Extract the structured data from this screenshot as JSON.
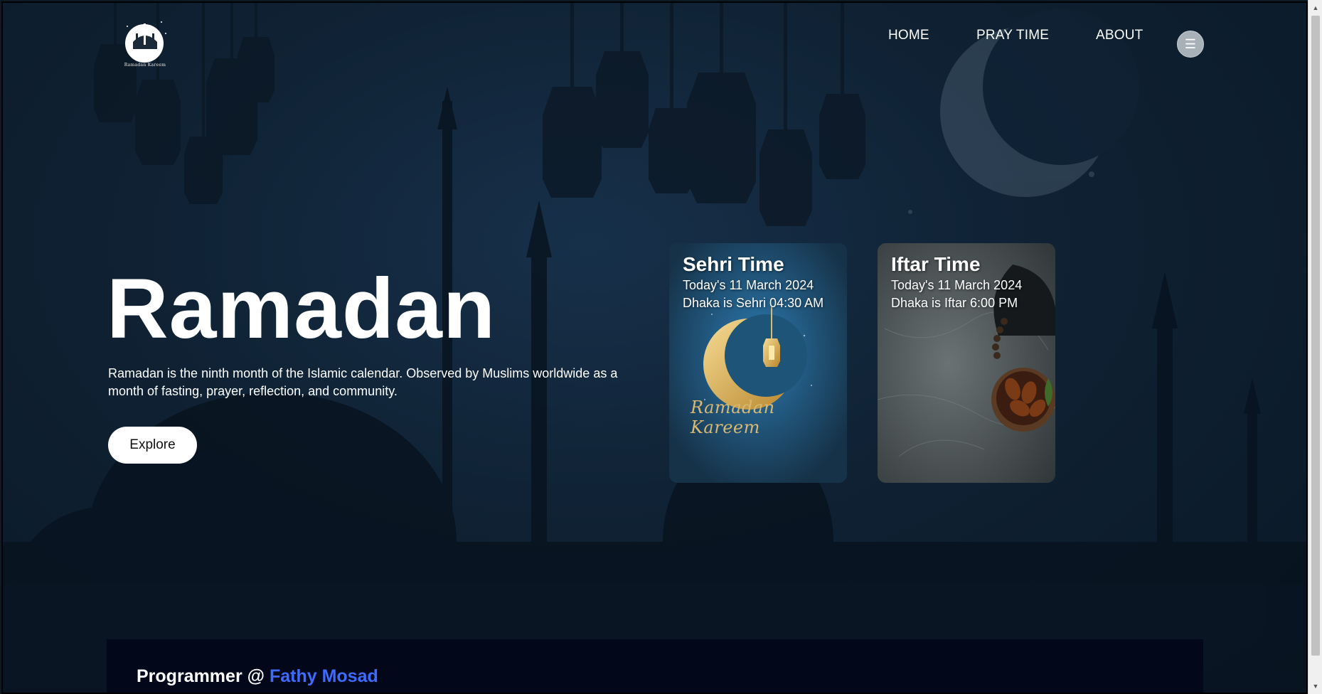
{
  "logo": {
    "caption": "Ramadan Kareem"
  },
  "nav": {
    "home": "HOME",
    "pray_time": "PRAY TIME",
    "about": "ABOUT",
    "menu_icon": "menu-icon"
  },
  "hero": {
    "title": "Ramadan",
    "description": "Ramadan is the ninth month of the Islamic calendar. Observed by Muslims worldwide as a month of fasting, prayer, reflection, and community.",
    "explore_label": "Explore"
  },
  "cards": [
    {
      "title": "Sehri Time",
      "date_line": "Today's 11 March 2024",
      "time_line": "Dhaka is Sehri 04:30 AM",
      "art_text": "Ramadan Kareem"
    },
    {
      "title": "Iftar Time",
      "date_line": "Today's 11 March 2024",
      "time_line": "Dhaka is Iftar 6:00 PM"
    }
  ],
  "footer": {
    "prefix": "Programmer @",
    "name": "Fathy Mosad"
  },
  "colors": {
    "background": "#0f2133",
    "accent_link": "#3d6bff",
    "footer_band": "#02081a"
  }
}
